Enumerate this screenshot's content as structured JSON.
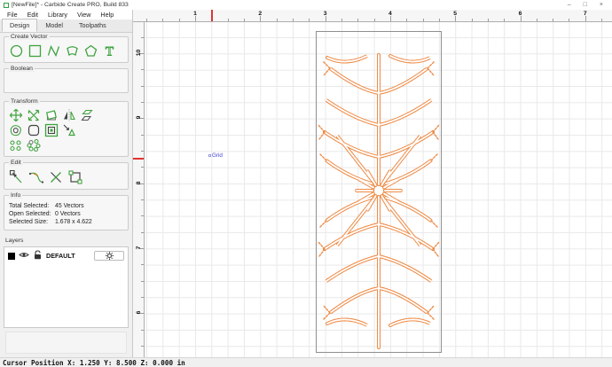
{
  "window": {
    "title": "[NewFile]* - Carbide Create PRO, Build 833",
    "minimize": "–",
    "maximize": "□",
    "close": "×"
  },
  "menu": {
    "items": [
      "File",
      "Edit",
      "Library",
      "View",
      "Help"
    ]
  },
  "tabs": {
    "items": [
      {
        "label": "Design",
        "active": true
      },
      {
        "label": "Model",
        "active": false
      },
      {
        "label": "Toolpaths",
        "active": false
      }
    ]
  },
  "sidebar": {
    "create_vector_label": "Create Vector",
    "create_vector_tools": [
      "circle-tool",
      "rectangle-tool",
      "polyline-tool",
      "curve-tool",
      "polygon-tool",
      "text-tool"
    ],
    "boolean_label": "Boolean",
    "transform_label": "Transform",
    "transform_tools": [
      "move-tool",
      "scale-tool",
      "rotate-tool",
      "flip-tool",
      "shear-tool",
      "offset-tool",
      "fillet-tool",
      "nested-align-tool",
      "trim-tool",
      "linear-array-tool",
      "circular-array-tool"
    ],
    "edit_label": "Edit",
    "edit_tools": [
      "node-edit-tool",
      "curve-edit-tool",
      "trim-vectors-tool",
      "join-vectors-tool"
    ],
    "info": {
      "label": "Info",
      "rows": [
        {
          "label": "Total Selected:",
          "value": "45 Vectors"
        },
        {
          "label": "Open Selected:",
          "value": "0 Vectors"
        },
        {
          "label": "Selected Size:",
          "value": "1.678 x 4.622"
        }
      ]
    },
    "layers": {
      "label": "Layers",
      "items": [
        {
          "name": "DEFAULT"
        }
      ]
    }
  },
  "canvas": {
    "ruler_x_labels": [
      "1",
      "2",
      "3",
      "4",
      "5",
      "6",
      "7"
    ],
    "ruler_y_labels": [
      "10",
      "9",
      "8",
      "7",
      "6"
    ],
    "grid_label": "Grid"
  },
  "status_bar": {
    "text": "Cursor Position X: 1.250 Y: 8.500 Z: 0.000 in"
  },
  "colors": {
    "tool_green": "#3fa33f",
    "selection_orange": "#ef8a45",
    "marker_red": "#e03232",
    "grid_blue": "#4242d8"
  }
}
